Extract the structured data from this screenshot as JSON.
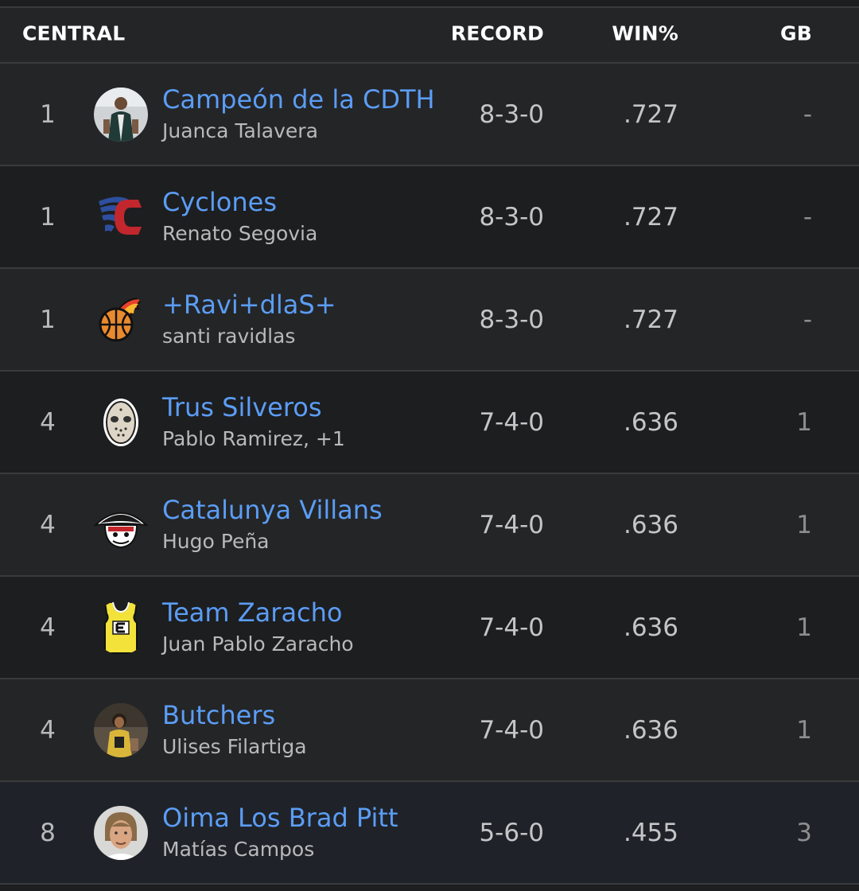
{
  "header": {
    "division": "CENTRAL",
    "record": "RECORD",
    "win_pct": "WIN%",
    "gb": "GB"
  },
  "colors": {
    "team_link": "#5b9df5",
    "background": "#1d1e20",
    "row_alt": "#242527"
  },
  "rows": [
    {
      "rank": "1",
      "team": "Campeón de la CDTH",
      "manager": "Juanca Talavera",
      "record": "8-3-0",
      "win_pct": ".727",
      "gb": "-",
      "logo_icon": "player-photo-avatar"
    },
    {
      "rank": "1",
      "team": "Cyclones",
      "manager": "Renato Segovia",
      "record": "8-3-0",
      "win_pct": ".727",
      "gb": "-",
      "logo_icon": "cyclone-c-logo"
    },
    {
      "rank": "1",
      "team": "+Ravi+dlaS+",
      "manager": "santi ravidlas",
      "record": "8-3-0",
      "win_pct": ".727",
      "gb": "-",
      "logo_icon": "flaming-basketball-logo"
    },
    {
      "rank": "4",
      "team": "Trus Silveros",
      "manager": "Pablo Ramirez, +1",
      "record": "7-4-0",
      "win_pct": ".636",
      "gb": "1",
      "logo_icon": "hockey-mask-logo"
    },
    {
      "rank": "4",
      "team": "Catalunya Villans",
      "manager": "Hugo Peña",
      "record": "7-4-0",
      "win_pct": ".636",
      "gb": "1",
      "logo_icon": "pirate-skull-logo"
    },
    {
      "rank": "4",
      "team": "Team Zaracho",
      "manager": "Juan Pablo Zaracho",
      "record": "7-4-0",
      "win_pct": ".636",
      "gb": "1",
      "logo_icon": "yellow-jersey-logo"
    },
    {
      "rank": "4",
      "team": "Butchers",
      "manager": "Ulises Filartiga",
      "record": "7-4-0",
      "win_pct": ".636",
      "gb": "1",
      "logo_icon": "player-photo-avatar"
    },
    {
      "rank": "8",
      "team": "Oima Los Brad Pitt",
      "manager": "Matías Campos",
      "record": "5-6-0",
      "win_pct": ".455",
      "gb": "3",
      "logo_icon": "person-photo-avatar"
    }
  ]
}
